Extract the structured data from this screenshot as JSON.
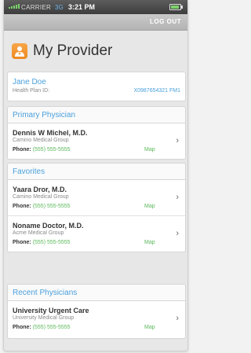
{
  "status_bar": {
    "carrier": "CARRIER",
    "network": "3G",
    "time": "3:21 PM"
  },
  "nav": {
    "logout_label": "LOG OUT"
  },
  "header": {
    "title": "My Provider",
    "icon": "person-icon",
    "accent_color": "#f39a2e"
  },
  "member": {
    "name": "Jane Doe",
    "plan_label": "Health Plan ID:",
    "plan_id": "X0987654321 FM1"
  },
  "colors": {
    "link": "#4aa0dd",
    "phone": "#5cb85c"
  },
  "sections": {
    "primary": {
      "title": "Primary Physician",
      "items": [
        {
          "name": "Dennis W Michel, M.D.",
          "group": "Camino Medical Group",
          "phone_label": "Phone:",
          "phone": "(555) 555-5555",
          "map": "Map"
        }
      ]
    },
    "favorites": {
      "title": "Favorites",
      "items": [
        {
          "name": "Yaara Dror, M.D.",
          "group": "Camino Medical Group",
          "phone_label": "Phone:",
          "phone": "(555) 555-5555",
          "map": "Map"
        },
        {
          "name": "Noname Doctor, M.D.",
          "group": "Acme Medical Group",
          "phone_label": "Phone:",
          "phone": "(555) 555-5555",
          "map": "Map"
        }
      ]
    },
    "recent": {
      "title": "Recent Physicians",
      "items": [
        {
          "name": "University Urgent Care",
          "group": "University Medical Group",
          "phone_label": "Phone:",
          "phone": "(555) 555-5555",
          "map": "Map"
        }
      ]
    }
  }
}
